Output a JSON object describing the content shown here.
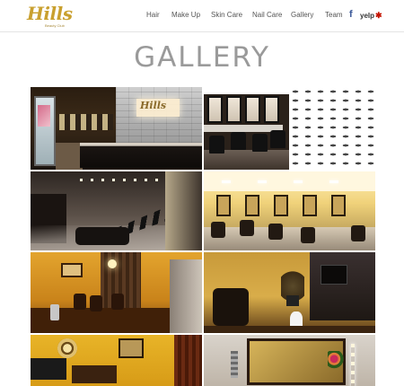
{
  "header": {
    "logo_text": "Hills",
    "logo_subtitle": "Beauty Club",
    "nav": [
      {
        "label": "Hair"
      },
      {
        "label": "Make Up"
      },
      {
        "label": "Skin Care"
      },
      {
        "label": "Nail Care"
      },
      {
        "label": "Gallery"
      },
      {
        "label": "Team"
      }
    ],
    "social": {
      "facebook_icon": "facebook-icon",
      "yelp_label": "yelp",
      "yelp_icon": "yelp-burst-icon"
    }
  },
  "page": {
    "title": "GALLERY"
  },
  "gallery": {
    "photos": [
      {
        "name": "reception-desk-photo"
      },
      {
        "name": "styling-stations-photo"
      },
      {
        "name": "salon-floor-photo"
      },
      {
        "name": "yellow-stations-photo"
      },
      {
        "name": "lounge-photo"
      },
      {
        "name": "treatment-room-photo"
      },
      {
        "name": "waiting-area-photo"
      },
      {
        "name": "mirror-vanity-photo"
      }
    ]
  },
  "colors": {
    "brand_gold": "#c9a02f",
    "facebook_blue": "#3b5998",
    "yelp_red": "#c41200",
    "title_gray": "#9a9a9a"
  }
}
